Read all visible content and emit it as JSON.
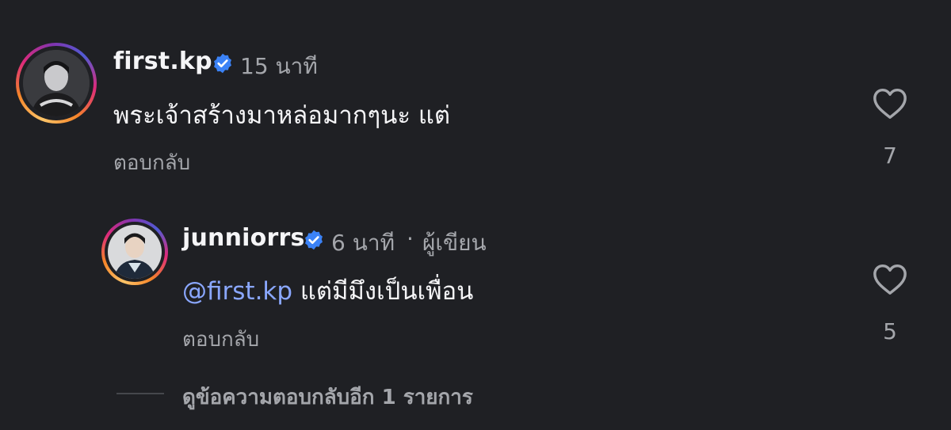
{
  "comments": [
    {
      "username": "first.kp",
      "verified": true,
      "time": "15 นาที",
      "text": "พระเจ้าสร้างมาหล่อมากๆนะ แต่",
      "reply_label": "ตอบกลับ",
      "likes": "7",
      "avatar_icon": "person-photo-avatar",
      "heart_icon": "heart-outline-icon"
    },
    {
      "username": "junniorrs",
      "verified": true,
      "time": "6 นาที",
      "separator": "·",
      "author_tag": "ผู้เขียน",
      "mention": "@first.kp",
      "text": "แต่มีมึงเป็นเพื่อน",
      "reply_label": "ตอบกลับ",
      "likes": "5",
      "avatar_icon": "person-photo-avatar",
      "heart_icon": "heart-outline-icon"
    }
  ],
  "view_more_replies": "ดูข้อความตอบกลับอีก 1 รายการ",
  "colors": {
    "background": "#1f2024",
    "verified_badge": "#3b82f6",
    "mention": "#8aa7ff",
    "muted_text": "#a4a6ab"
  }
}
